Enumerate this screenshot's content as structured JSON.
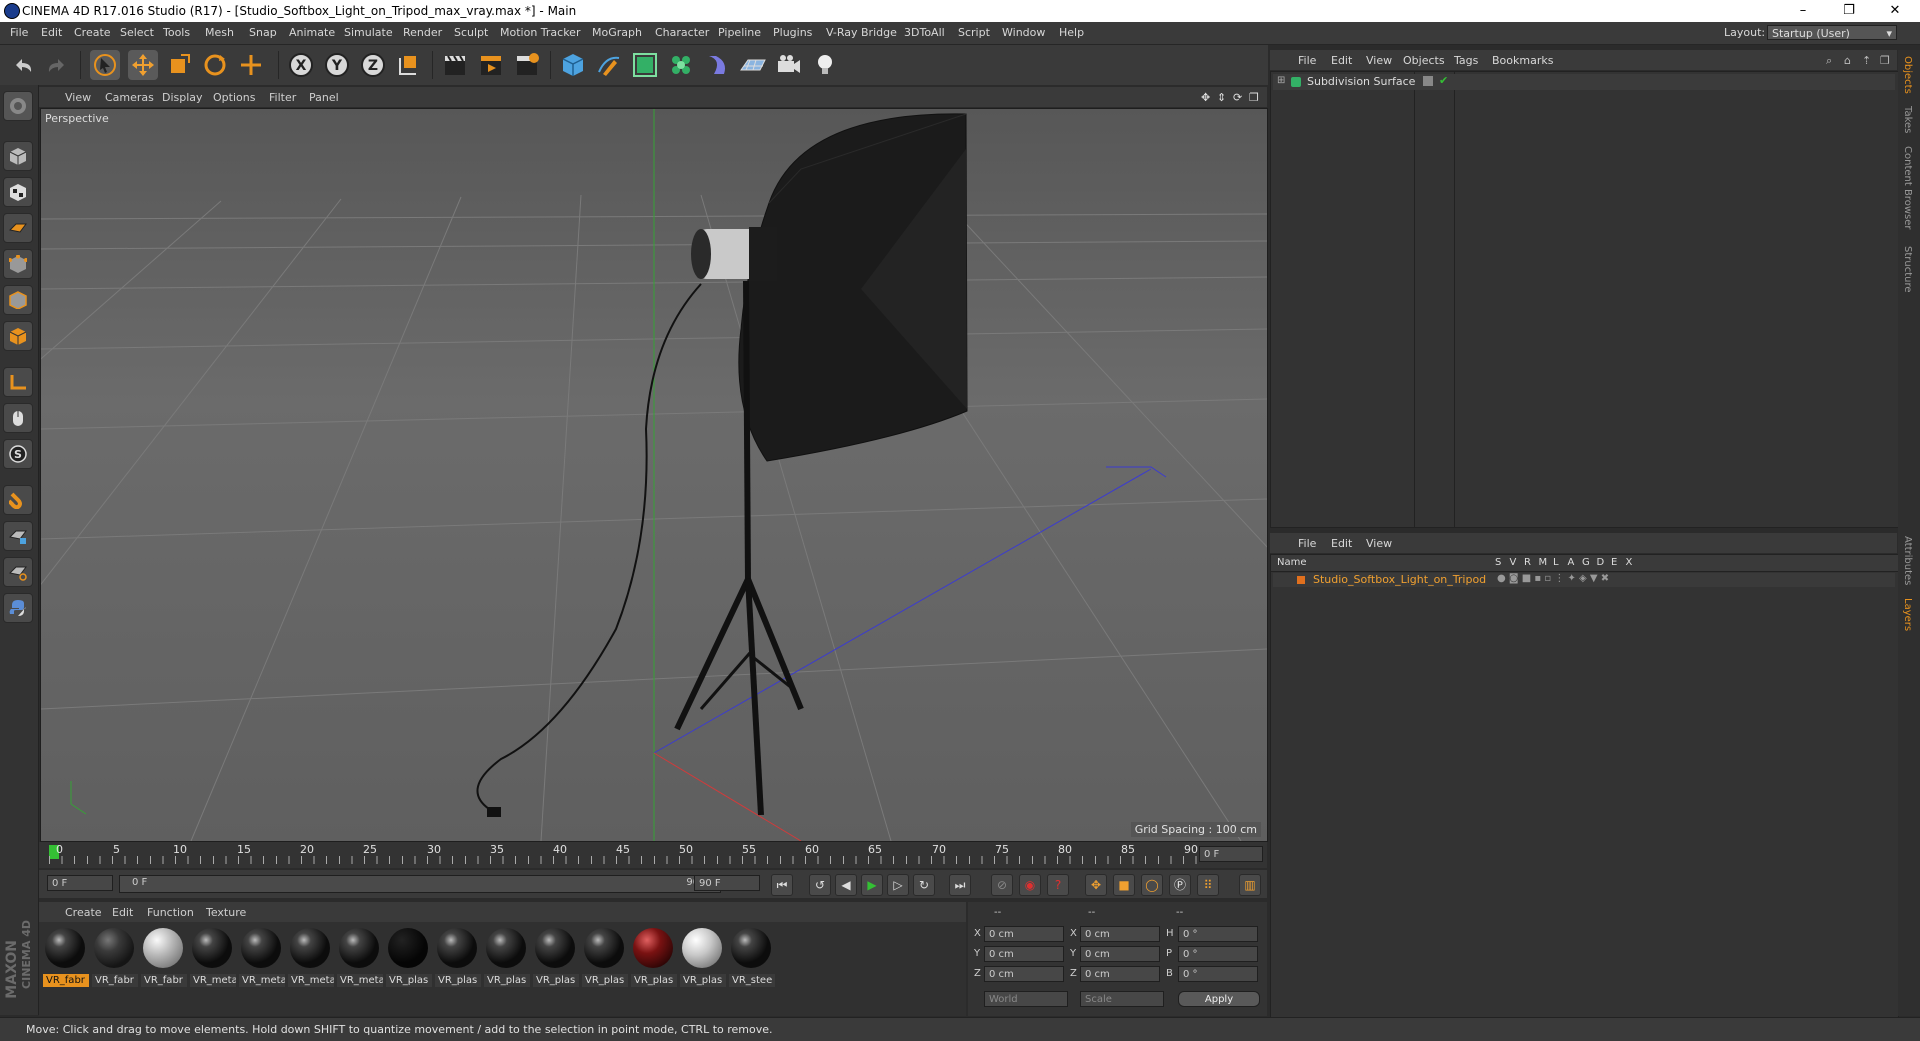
{
  "window": {
    "title": "CINEMA 4D R17.016 Studio (R17) - [Studio_Softbox_Light_on_Tripod_max_vray.max *] - Main",
    "controls": [
      "–",
      "❐",
      "✕"
    ]
  },
  "menubar": {
    "items": [
      "File",
      "Edit",
      "Create",
      "Select",
      "Tools",
      "Mesh",
      "Snap",
      "Animate",
      "Simulate",
      "Render",
      "Sculpt",
      "Motion Tracker",
      "MoGraph",
      "Character",
      "Pipeline",
      "Plugins",
      "V-Ray Bridge",
      "3DToAll",
      "Script",
      "Window",
      "Help"
    ],
    "layout_label": "Layout:",
    "layout_value": "Startup (User)"
  },
  "viewport": {
    "menu": [
      "View",
      "Cameras",
      "Display",
      "Options",
      "Filter",
      "Panel"
    ],
    "camera_label": "Perspective",
    "grid_spacing": "Grid Spacing : 100 cm"
  },
  "timeline": {
    "ticks": [
      "0",
      "5",
      "10",
      "15",
      "20",
      "25",
      "30",
      "35",
      "40",
      "45",
      "50",
      "55",
      "60",
      "65",
      "70",
      "75",
      "80",
      "85",
      "90"
    ],
    "current_frame": "0 F",
    "start_frame": "0 F",
    "range_start": "0 F",
    "range_end": "90 F",
    "end_frame": "90 F"
  },
  "materials": {
    "menu": [
      "Create",
      "Edit",
      "Function",
      "Texture"
    ],
    "items": [
      {
        "label": "VR_fabr",
        "color": "dark-glossy",
        "selected": true
      },
      {
        "label": "VR_fabr",
        "color": "dark-matte"
      },
      {
        "label": "VR_fabr",
        "color": "grey"
      },
      {
        "label": "VR_meta",
        "color": "dark-glossy"
      },
      {
        "label": "VR_meta",
        "color": "dark-glossy"
      },
      {
        "label": "VR_meta",
        "color": "dark-glossy"
      },
      {
        "label": "VR_meta",
        "color": "dark-glossy"
      },
      {
        "label": "VR_plas",
        "color": "black"
      },
      {
        "label": "VR_plas",
        "color": "dark-glossy"
      },
      {
        "label": "VR_plas",
        "color": "dark-glossy"
      },
      {
        "label": "VR_plas",
        "color": "dark-glossy"
      },
      {
        "label": "VR_plas",
        "color": "dark-glossy"
      },
      {
        "label": "VR_plas",
        "color": "red"
      },
      {
        "label": "VR_plas",
        "color": "light"
      },
      {
        "label": "VR_stee",
        "color": "dark-glossy"
      }
    ]
  },
  "coordinates": {
    "header": [
      "--",
      "--",
      "--"
    ],
    "rows": [
      {
        "a": "X",
        "av": "0 cm",
        "b": "X",
        "bv": "0 cm",
        "c": "H",
        "cv": "0 °"
      },
      {
        "a": "Y",
        "av": "0 cm",
        "b": "Y",
        "bv": "0 cm",
        "c": "P",
        "cv": "0 °"
      },
      {
        "a": "Z",
        "av": "0 cm",
        "b": "Z",
        "bv": "0 cm",
        "c": "B",
        "cv": "0 °"
      }
    ],
    "mode1": "World",
    "mode2": "Scale",
    "apply": "Apply"
  },
  "objects": {
    "menu": [
      "File",
      "Edit",
      "View",
      "Objects",
      "Tags",
      "Bookmarks"
    ],
    "items": [
      {
        "name": "Subdivision Surface"
      }
    ]
  },
  "layers": {
    "menu": [
      "File",
      "Edit",
      "View"
    ],
    "header_name": "Name",
    "columns": [
      "S",
      "V",
      "R",
      "M",
      "L",
      "A",
      "G",
      "D",
      "E",
      "X"
    ],
    "items": [
      {
        "name": "Studio_Softbox_Light_on_Tripod",
        "color": "#e0701e"
      }
    ]
  },
  "sidetabs": [
    "Objects",
    "Takes",
    "Content Browser",
    "Structure",
    "Attributes",
    "Layers"
  ],
  "status": "Move: Click and drag to move elements. Hold down SHIFT to quantize movement / add to the selection in point mode, CTRL to remove.",
  "brand": {
    "maxon": "MAXON",
    "product": "CINEMA 4D"
  },
  "colors": {
    "accent": "#e8921e",
    "panel": "#333333",
    "viewport": "#5f5f5f",
    "highlight": "#f0a030"
  }
}
